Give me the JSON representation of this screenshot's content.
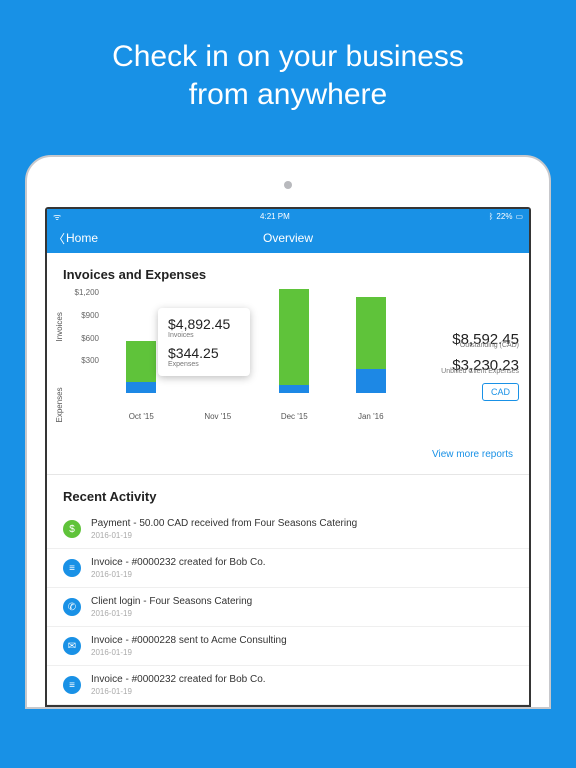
{
  "hero": {
    "line1": "Check in on your business",
    "line2": "from anywhere"
  },
  "statusbar": {
    "carrier": "",
    "time": "4:21 PM",
    "bt": "22%"
  },
  "navbar": {
    "back": "Home",
    "title": "Overview"
  },
  "chart_section_title": "Invoices and Expenses",
  "axis_inv_label": "Invoices",
  "axis_exp_label": "Expenses",
  "ticks": [
    "$1,200",
    "$900",
    "$600",
    "$300"
  ],
  "chart_data": {
    "type": "bar",
    "categories": [
      "Oct '15",
      "Nov '15",
      "Dec '15",
      "Jan '16"
    ],
    "series": [
      {
        "name": "Invoices",
        "values": [
          460,
          0,
          1100,
          820
        ]
      },
      {
        "name": "Expenses",
        "values": [
          130,
          0,
          90,
          280
        ]
      }
    ],
    "ylim": [
      0,
      1200
    ],
    "ylabel_top": "Invoices",
    "ylabel_bottom": "Expenses"
  },
  "tooltip": {
    "inv_value": "$4,892.45",
    "inv_label": "Invoices",
    "exp_value": "$344.25",
    "exp_label": "Expenses"
  },
  "summary": {
    "outstanding_value": "$8,592.45",
    "outstanding_label": "Outstanding (CAD)",
    "unbilled_value": "$3,230.23",
    "unbilled_label": "Unbilled Client Expenses",
    "currency_btn": "CAD"
  },
  "view_more": "View more reports",
  "recent_title": "Recent Activity",
  "activity": [
    {
      "icon": "dollar",
      "color": "green",
      "text": "Payment - 50.00 CAD received from Four Seasons Catering",
      "date": "2016-01-19"
    },
    {
      "icon": "doc",
      "color": "blue",
      "text": "Invoice - #0000232 created for Bob Co.",
      "date": "2016-01-19"
    },
    {
      "icon": "phone",
      "color": "blue",
      "text": "Client login - Four Seasons Catering",
      "date": "2016-01-19"
    },
    {
      "icon": "mail",
      "color": "blue",
      "text": "Invoice - #0000228 sent to Acme Consulting",
      "date": "2016-01-19"
    },
    {
      "icon": "doc",
      "color": "blue",
      "text": "Invoice - #0000232 created for Bob Co.",
      "date": "2016-01-19"
    }
  ],
  "icon_glyphs": {
    "dollar": "$",
    "doc": "≡",
    "phone": "✆",
    "mail": "✉"
  }
}
